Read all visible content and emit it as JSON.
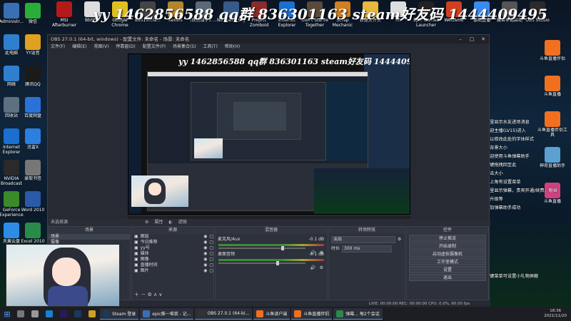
{
  "overlay": {
    "banner": "yy 1462856588 qq群 836301163 steam好友码 1444409495"
  },
  "desktop_left_icons": [
    {
      "label": "Administr...",
      "icon": "user-icon",
      "color": "#3a6fb5"
    },
    {
      "label": "此电脑",
      "icon": "computer-icon",
      "color": "#2f7fcf"
    },
    {
      "label": "网络",
      "icon": "network-icon",
      "color": "#2f7fcf"
    },
    {
      "label": "回收站",
      "icon": "recycle-bin-icon",
      "color": "#5c7080"
    },
    {
      "label": "Internet Explorer",
      "icon": "ie-icon",
      "color": "#1a6fd0"
    },
    {
      "label": "NVIDIA Broadcast",
      "icon": "nvidia-icon",
      "color": "#2a2a2a"
    },
    {
      "label": "GeForce Experience",
      "icon": "geforce-icon",
      "color": "#3a8a2a"
    },
    {
      "label": "天翼云盘",
      "icon": "cloud-icon",
      "color": "#2d8de6"
    }
  ],
  "desktop_col2_icons": [
    {
      "label": "微信",
      "icon": "wechat-icon",
      "color": "#2aae3a"
    },
    {
      "label": "YY语音",
      "icon": "yy-icon",
      "color": "#e0a020"
    },
    {
      "label": "腾讯QQ",
      "icon": "qq-icon",
      "color": "#1a1a1a"
    },
    {
      "label": "百度网盘",
      "icon": "baidu-pan-icon",
      "color": "#2a72d8"
    },
    {
      "label": "迅雷X",
      "icon": "xunlei-icon",
      "color": "#2a7fe0"
    },
    {
      "label": "录取书签",
      "icon": "bookmark-icon",
      "color": "#777"
    },
    {
      "label": "Word 2010",
      "icon": "word-icon",
      "color": "#2a5aa8"
    },
    {
      "label": "Excel 2010",
      "icon": "excel-icon",
      "color": "#2a8a4a"
    }
  ],
  "desktop_top_icons": [
    {
      "label": "MSI Afterburner",
      "icon": "msi-icon",
      "color": "#b51a1a"
    },
    {
      "label": "BbSF...",
      "icon": "file-icon",
      "color": "#ddd"
    },
    {
      "label": "Google Chrome",
      "icon": "chrome-icon",
      "color": "#e0c020"
    },
    {
      "label": "ed019fcfa...",
      "icon": "image-icon",
      "color": "#444"
    },
    {
      "label": "Kenshi",
      "icon": "kenshi-icon",
      "color": "#b2862f"
    },
    {
      "label": "(铁锈战争5 ...",
      "icon": "game-icon",
      "color": "#5a6a78"
    },
    {
      "label": "No Man's Sky",
      "icon": "nms-icon",
      "color": "#385a8a"
    },
    {
      "label": "Project Zomboid",
      "icon": "zomboid-icon",
      "color": "#8a2a2a"
    },
    {
      "label": "Internet Explorer",
      "icon": "ie-icon",
      "color": "#1a6fd0"
    },
    {
      "label": "Don't Starve Together",
      "icon": "dst-icon",
      "color": "#5a4a3a"
    },
    {
      "label": "Scrap Mechanic",
      "icon": "scrap-icon",
      "color": "#d08020"
    },
    {
      "label": "新建文件夹",
      "icon": "folder-icon",
      "color": "#e8b83a"
    },
    {
      "label": "nn",
      "icon": "file-icon",
      "color": "#ddd"
    },
    {
      "label": "Epic Games Launcher",
      "icon": "epic-icon",
      "color": "#222"
    },
    {
      "label": "WeGame",
      "icon": "wegame-icon",
      "color": "#d04020"
    },
    {
      "label": "暴雨直播",
      "icon": "app-icon",
      "color": "#3a8af0"
    },
    {
      "label": "魔兽争霸启动",
      "icon": "game-icon",
      "color": "#555"
    },
    {
      "label": "OBS Studio",
      "icon": "obs-icon",
      "color": "#2a2a2a"
    }
  ],
  "desktop_right_icons": [
    {
      "label": "斗鱼直播伴侣",
      "icon": "douyu-icon",
      "color": "#f07020"
    },
    {
      "label": "斗鱼直播",
      "icon": "douyu-icon",
      "color": "#f07020"
    },
    {
      "label": "斗鱼直播伴侣工具",
      "icon": "douyu-icon",
      "color": "#f07020"
    },
    {
      "label": "神奇直播助手",
      "icon": "app-icon",
      "color": "#5aa0d0"
    },
    {
      "label": "斗鱼直播",
      "icon": "douyu-icon",
      "color": "#d04080"
    }
  ],
  "obs": {
    "title": "OBS 27.0.1 (64-bit, windows) - 配置文件: 未命名 - 场景: 未命名",
    "menu": [
      "文件(F)",
      "编辑(E)",
      "视图(V)",
      "停靠窗(D)",
      "配置文件(P)",
      "场景集合(S)",
      "工具(T)",
      "帮助(H)"
    ],
    "no_source_selected": "未选择源",
    "properties_btn": "属性",
    "filters_btn": "滤镜",
    "dock_titles": {
      "scenes": "场景",
      "sources": "来源",
      "mixer": "混音器",
      "transitions": "转场特效",
      "controls": "控件"
    },
    "scenes": [
      "场景",
      "摄像"
    ],
    "sources": [
      "图层",
      "今日推荐",
      "yy号",
      "媒体",
      "图像",
      "直播时间",
      "图片"
    ],
    "mixer": [
      {
        "name": "麦克风/Aux",
        "db": "-0.1 dB",
        "level": 0.72
      },
      {
        "name": "桌面音频",
        "db": "-0.1 dB",
        "level": 0.66
      }
    ],
    "transition": {
      "type": "淡出",
      "duration_label": "时长",
      "duration": "300 ms"
    },
    "controls": [
      "停止推流",
      "开始录制",
      "启动虚拟摄像机",
      "工作室模式",
      "设置",
      "退出"
    ],
    "status": "LIVE: 00:00:00   REC: 00:00:00   CPU: 0.0%, 60.00 fps"
  },
  "inner_preview_banner": "yy 1462856588 qq群 836301163 steam好友码 1444409495",
  "chat": [
    "这里显示水友进场消息",
    "欢迎主播(LV15)进入",
    "可以修改此处的字体样式",
    "和背景大小",
    "欢迎使用斗鱼弹幕助手",
    "左键拖拽回至此",
    "双击大小",
    "右上角有设置菜单",
    "这里显示弹幕，贵宾开通/续费，粉丝",
    "牌升级等",
    "添加弹幕助手成功"
  ],
  "chat_bottom": "右键菜单可设置小礼物屏蔽",
  "taskbar": {
    "items": [
      {
        "label": "",
        "icon": "search-icon"
      },
      {
        "label": "",
        "icon": "task-view-icon"
      },
      {
        "label": "",
        "icon": "edge-icon"
      },
      {
        "label": "",
        "icon": "premiere-icon"
      },
      {
        "label": "",
        "icon": "steam-icon"
      },
      {
        "label": "",
        "icon": "chrome-icon"
      },
      {
        "label": "Steam 登录",
        "icon": "steam-icon"
      },
      {
        "label": "epic推一堆我 - 记...",
        "icon": "browser-icon"
      },
      {
        "label": "OBS 27.0.1 (64-bi...",
        "icon": "obs-icon"
      },
      {
        "label": "斗鱼读户端",
        "icon": "douyu-icon"
      },
      {
        "label": "斗鱼直播伴侣",
        "icon": "douyu-icon"
      },
      {
        "label": "弹幕...  每2个会话",
        "icon": "chat-icon"
      }
    ],
    "time": "18:36",
    "date": "2021/11/20"
  },
  "colors": {
    "accent": "#4aa0ff",
    "obs_bg": "#272a33"
  }
}
